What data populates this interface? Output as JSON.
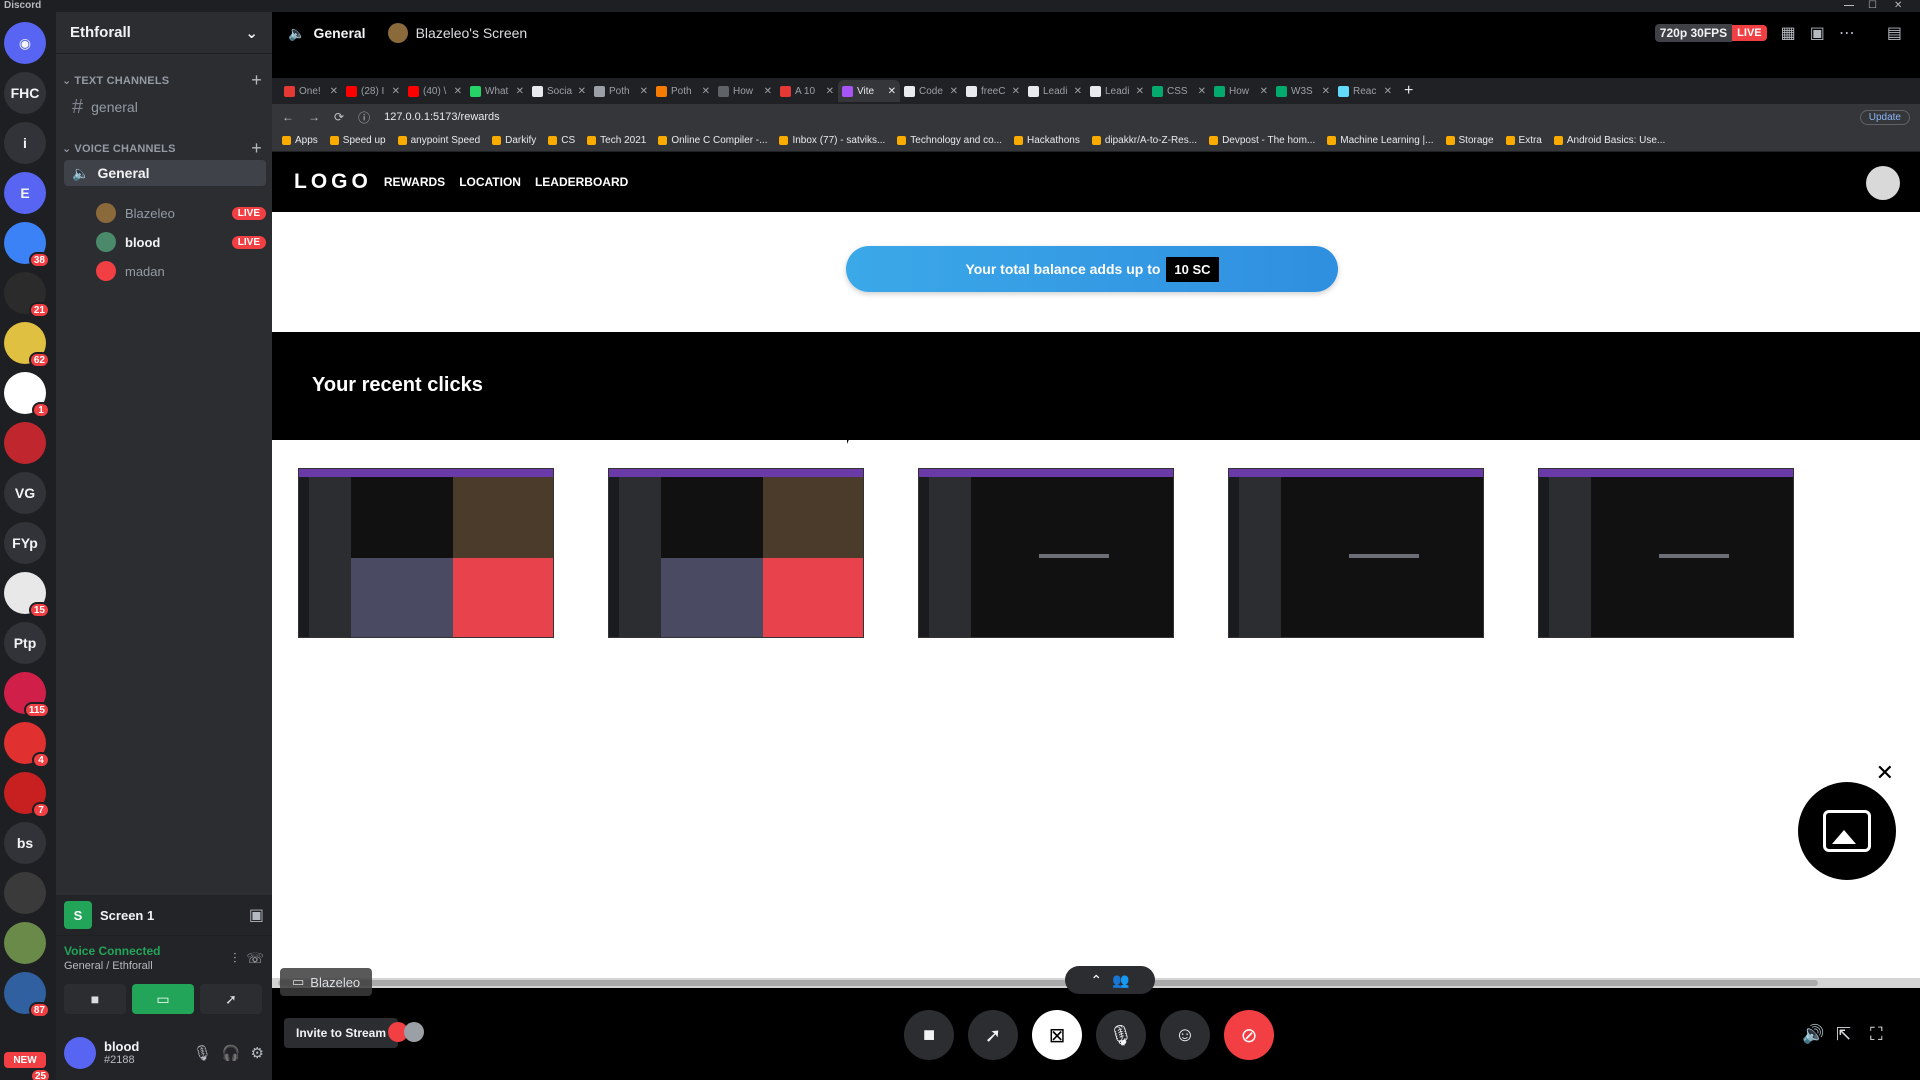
{
  "window": {
    "brand": "Discord"
  },
  "rail": {
    "servers": [
      {
        "label": "",
        "badge": "",
        "color": "#5865f2",
        "icon": "discord-icon"
      },
      {
        "label": "FHC",
        "badge": "",
        "color": "#313338"
      },
      {
        "label": "i",
        "badge": "",
        "color": "#313338"
      },
      {
        "label": "E",
        "badge": "",
        "color": "#5865f2"
      },
      {
        "label": "",
        "badge": "38",
        "color": "#3b82f6"
      },
      {
        "label": "",
        "badge": "21",
        "color": "#2b2b2b"
      },
      {
        "label": "",
        "badge": "62",
        "color": "#e0c040"
      },
      {
        "label": "",
        "badge": "1",
        "color": "#ffffff"
      },
      {
        "label": "",
        "badge": "",
        "color": "#c0262d"
      },
      {
        "label": "VG",
        "badge": "",
        "color": "#313338"
      },
      {
        "label": "FYp",
        "badge": "",
        "color": "#313338"
      },
      {
        "label": "",
        "badge": "15",
        "color": "#e8e8e8"
      },
      {
        "label": "Ptp",
        "badge": "",
        "color": "#313338"
      },
      {
        "label": "",
        "badge": "115",
        "color": "#d0204a"
      },
      {
        "label": "",
        "badge": "4",
        "color": "#e03030"
      },
      {
        "label": "",
        "badge": "7",
        "color": "#c82020"
      },
      {
        "label": "bs",
        "badge": "",
        "color": "#313338"
      },
      {
        "label": "",
        "badge": "",
        "color": "#3a3a3a"
      },
      {
        "label": "",
        "badge": "",
        "color": "#6a8a4a"
      },
      {
        "label": "",
        "badge": "87",
        "color": "#3060a0"
      }
    ],
    "new_badge": "NEW",
    "new_count": "25"
  },
  "sidebar": {
    "guild": "Ethforall",
    "text_category": "TEXT CHANNELS",
    "text_channels": [
      "general"
    ],
    "voice_category": "VOICE CHANNELS",
    "voice_channel": "General",
    "voice_users": [
      {
        "name": "Blazeleo",
        "live": "LIVE",
        "color": "#8a6a3a"
      },
      {
        "name": "blood",
        "live": "LIVE",
        "color": "#4a8a6a"
      },
      {
        "name": "madan",
        "live": "",
        "color": "#f23f43"
      }
    ],
    "screen_panel": {
      "icon_letter": "S",
      "label": "Screen 1"
    },
    "voice_panel": {
      "status": "Voice Connected",
      "location": "General / Ethforall"
    },
    "user": {
      "name": "blood",
      "tag": "#2188"
    }
  },
  "stream": {
    "channel": "General",
    "screen_title": "Blazeleo's Screen",
    "quality": "720p 30FPS",
    "live": "LIVE",
    "share_label": "Blazeleo",
    "invite_label": "Invite to Stream"
  },
  "browser": {
    "tabs": [
      {
        "label": "One!",
        "color": "#e53935"
      },
      {
        "label": "(28) I",
        "color": "#ff0000"
      },
      {
        "label": "(40) \\",
        "color": "#ff0000"
      },
      {
        "label": "What",
        "color": "#25d366"
      },
      {
        "label": "Socia",
        "color": "#e8eaed"
      },
      {
        "label": "Poth",
        "color": "#9aa0a6"
      },
      {
        "label": "Poth",
        "color": "#f57c00"
      },
      {
        "label": "How",
        "color": "#5f6368"
      },
      {
        "label": "A 10",
        "color": "#e53935"
      },
      {
        "label": "Vite",
        "color": "#a855f7"
      },
      {
        "label": "Code",
        "color": "#e8eaed"
      },
      {
        "label": "freeC",
        "color": "#e8eaed"
      },
      {
        "label": "Leadi",
        "color": "#e8eaed"
      },
      {
        "label": "Leadi",
        "color": "#e8eaed"
      },
      {
        "label": "CSS",
        "color": "#04aa6d"
      },
      {
        "label": "How",
        "color": "#04aa6d"
      },
      {
        "label": "W3S",
        "color": "#04aa6d"
      },
      {
        "label": "Reac",
        "color": "#61dafb"
      }
    ],
    "active_tab_index": 9,
    "url": "127.0.0.1:5173/rewards",
    "update_label": "Update",
    "bookmarks": [
      "Apps",
      "Speed up",
      "anypoint Speed",
      "Darkify",
      "CS",
      "Tech 2021",
      "Online C Compiler -...",
      "Inbox (77) - satviks...",
      "Technology and co...",
      "Hackathons",
      "dipakkr/A-to-Z-Res...",
      "Devpost - The hom...",
      "Machine Learning |...",
      "Storage",
      "Extra",
      "Android Basics: Use..."
    ]
  },
  "webpage": {
    "logo": "LOGO",
    "nav": [
      "REWARDS",
      "LOCATION",
      "LEADERBOARD"
    ],
    "balance_text": "Your total balance adds up to",
    "balance_value": "10 SC",
    "recent_title": "Your recent clicks",
    "thumbnails": [
      {
        "variant": "grid"
      },
      {
        "variant": "grid"
      },
      {
        "variant": "blank"
      },
      {
        "variant": "blank"
      },
      {
        "variant": "blank"
      }
    ]
  }
}
